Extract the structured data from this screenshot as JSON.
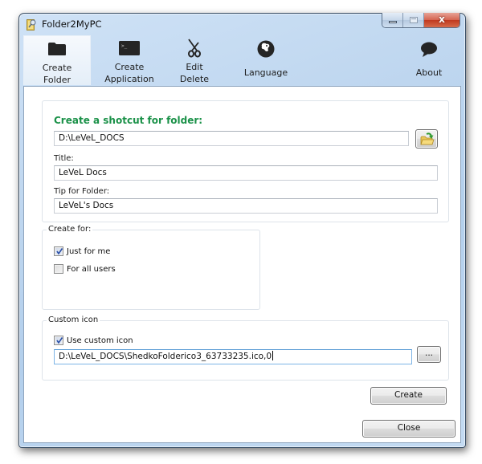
{
  "window": {
    "title": "Folder2MyPC",
    "controls": {
      "minimize": "minimize",
      "maximize": "maximize",
      "close": "x"
    }
  },
  "toolbar": {
    "items": [
      {
        "line1": "Create",
        "line2": "Folder",
        "icon": "folder-icon",
        "active": true
      },
      {
        "line1": "Create",
        "line2": "Application",
        "icon": "terminal-icon",
        "active": false
      },
      {
        "line1": "Edit",
        "line2": "Delete",
        "icon": "scissors-icon",
        "active": false
      },
      {
        "line1": "Language",
        "line2": "",
        "icon": "globe-icon",
        "active": false
      },
      {
        "line1": "About",
        "line2": "",
        "icon": "speech-bubble-icon",
        "active": false
      }
    ]
  },
  "shortcut_panel": {
    "heading": "Create a shotcut for folder:",
    "heading_color": "#1a9148",
    "folder_path": "D:\\LeVeL_DOCS",
    "title_label": "Title:",
    "title_value": "LeVeL Docs",
    "tip_label": "Tip for Folder:",
    "tip_value": "LeVeL's Docs"
  },
  "create_for": {
    "legend": "Create for:",
    "options": [
      {
        "label": "Just for me",
        "checked": true
      },
      {
        "label": "For all users",
        "checked": false
      }
    ]
  },
  "custom_icon": {
    "legend": "Custom icon",
    "use_label": "Use custom icon",
    "use_checked": true,
    "icon_path": "D:\\LeVeL_DOCS\\ShedkoFolderico3_63733235.ico,0",
    "browse_label": "..."
  },
  "buttons": {
    "create": "Create",
    "close": "Close"
  }
}
